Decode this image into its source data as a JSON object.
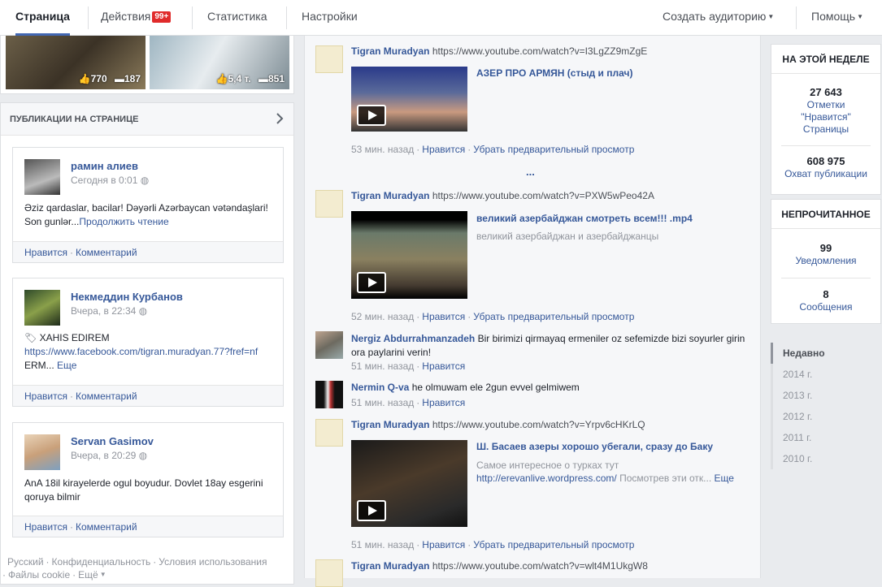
{
  "topbar": {
    "tabs": [
      "Страница",
      "Действия",
      "Статистика",
      "Настройки"
    ],
    "badge": "99+",
    "create_audience": "Создать аудиторию",
    "help": "Помощь"
  },
  "photos": [
    {
      "likes": "770",
      "comments": "187"
    },
    {
      "likes": "5,4 т.",
      "comments": "851"
    }
  ],
  "page_posts": {
    "title": "ПУБЛИКАЦИИ НА СТРАНИЦЕ",
    "posts": [
      {
        "name": "рамин алиев",
        "time": "Сегодня в 0:01",
        "text": "Əziz qardaslar, bacilar! Dəyərli Azərbaycan vətəndaşlari! Son gunlər...",
        "more": "Продолжить чтение",
        "like": "Нравится",
        "comment": "Комментарий"
      },
      {
        "name": "Некмеддин Курбанов",
        "time": "Вчера, в 22:34",
        "tag": "XAHIS EDIREM",
        "link": "https://www.facebook.com/tigran.muradyan.77?fref=nf",
        "text": " ERM...",
        "more": " Еще",
        "like": "Нравится",
        "comment": "Комментарий"
      },
      {
        "name": "Servan Gasimov",
        "time": "Вчера, в 20:29",
        "text": "AnA 18il kirayelerde ogul boyudur. Dovlet 18ay esgerini qoruya bilmir",
        "like": "Нравится",
        "comment": "Комментарий"
      }
    ]
  },
  "footer": {
    "links": [
      "Русский",
      "Конфиденциальность",
      "Условия использования",
      "Файлы cookie",
      "Ещё"
    ]
  },
  "feed": {
    "items": [
      {
        "name": "Tigran Muradyan",
        "url": "https://www.youtube.com/watch?v=I3LgZZ9mZgE",
        "title": "АЗЕР ПРО АРМЯН (стыд и плач)",
        "time": "53 мин. назад",
        "like": "Нравится",
        "remove": "Убрать предварительный просмотр"
      },
      {
        "name": "Tigran Muradyan",
        "url": "https://www.youtube.com/watch?v=PXW5wPeo42A",
        "title": "великий азербайджан смотреть всем!!! .mp4",
        "desc": "великий азербайджан и азербайджанцы",
        "time": "52 мин. назад",
        "like": "Нравится",
        "remove": "Убрать предварительный просмотр"
      },
      {
        "name": "Tigran Muradyan",
        "url": "https://www.youtube.com/watch?v=Yrpv6cHKrLQ",
        "title": "Ш. Басаев азеры хорошо убегали, сразу до Баку",
        "desc1": "Самое интересное о турках тут ",
        "desc_link": "http://erevanlive.wordpress.com/",
        "desc2": " Посмотрев эти отк...",
        "desc_more": "Еще",
        "time": "51 мин. назад",
        "like": "Нравится",
        "remove": "Убрать предварительный просмотр"
      },
      {
        "name": "Tigran Muradyan",
        "url": "https://www.youtube.com/watch?v=wlt4M1UkgW8"
      }
    ],
    "ellipsis": "...",
    "comments": [
      {
        "name": "Nergiz Abdurrahmanzadeh",
        "text": "Bir birimizi qirmayaq ermeniler oz sefemizde bizi soyurler girin ora paylarini verin!",
        "time": "51 мин. назад",
        "like": "Нравится"
      },
      {
        "name": "Nermin Q-va",
        "text": "he olmuwam ele 2gun evvel gelmiwem",
        "time": "51 мин. назад",
        "like": "Нравится"
      }
    ]
  },
  "right": {
    "this_week": "НА ЭТОЙ НЕДЕЛЕ",
    "likes_value": "27 643",
    "likes_label": "Отметки \"Нравится\" Страницы",
    "reach_value": "608 975",
    "reach_label": "Охват публикации",
    "unread": "НЕПРОЧИТАННОЕ",
    "notif_value": "99",
    "notif_label": "Уведомления",
    "msg_value": "8",
    "msg_label": "Сообщения",
    "years": [
      "Недавно",
      "2014 г.",
      "2013 г.",
      "2012 г.",
      "2011 г.",
      "2010 г."
    ]
  }
}
